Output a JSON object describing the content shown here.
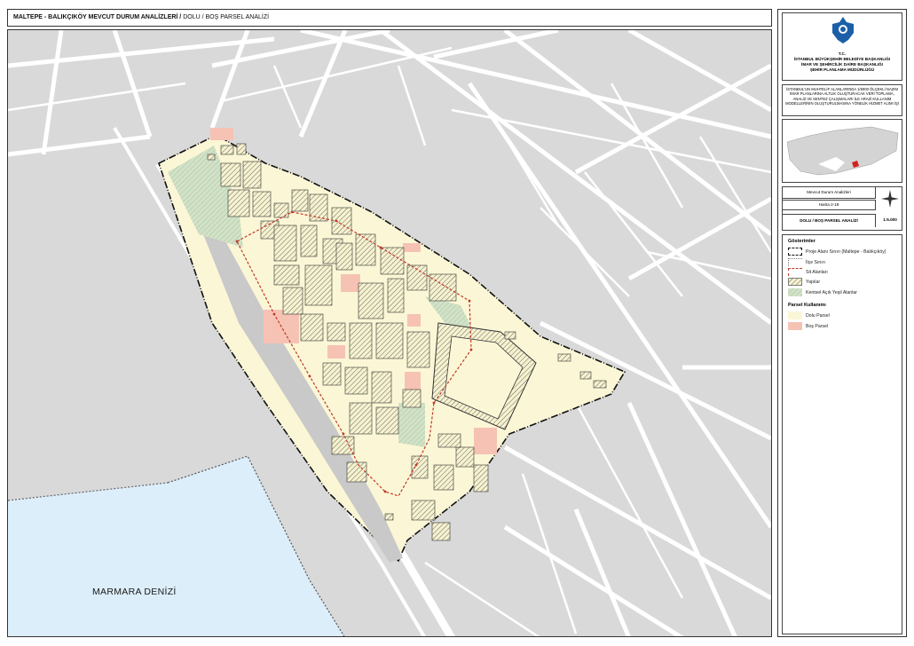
{
  "title": {
    "main": "MALTEPE - BALIKÇIKÖY MEVCUT DURUM ANALİZLERİ /",
    "sub": "DOLU / BOŞ PARSEL ANALİZİ"
  },
  "map": {
    "sea_label": "MARMARA DENİZİ"
  },
  "header": {
    "tc": "T.C.",
    "org1": "İSTANBUL BÜYÜKŞEHİR BELEDİYE BAŞKANLIĞI",
    "org2": "İMAR VE ŞEHİRCİLİK DAİRE BAŞKANLIĞI",
    "org3": "ŞEHİR PLANLAMA MÜDÜRLÜĞÜ"
  },
  "project_description": "İSTANBUL'UN MUHTELİF ALANLARINDA 1/5000 ÖLÇEKLİ NAZIM İMAR PLANLARINA ALTLIK OLUŞTURACAK VERİ TOPLAMA, ANALİZ VE SENTEZ ÇALIŞMALARI İLE ARAZİ KULLANIM MODELLERİNİN OLUŞTURULMASINA YÖNELİK HİZMET ALIMI İŞİ",
  "info": {
    "analysis_label": "Mevcut Durum Analizleri",
    "map_no": "Harita 2-18",
    "map_title": "DOLU / BOŞ PARSEL ANALİZİ",
    "scale": "1:5.000"
  },
  "legend": {
    "title": "Gösterimler",
    "items": [
      "Proje Alanı Sınırı (Maltepe - Balıkçıköy)",
      "İlçe Sınırı",
      "Sit Alanları",
      "Yapılar",
      "Kentsel Açık Yeşil Alanlar"
    ],
    "parcel_title": "Parsel Kullanımı",
    "parcel_items": [
      "Dolu Parsel",
      "Boş Parsel"
    ]
  },
  "colors": {
    "full_parcel": "#fbf7d6",
    "empty_parcel": "#f6c2b4",
    "sea": "#dceefa",
    "green": "#c9dcc0",
    "site": "#c0392b",
    "background": "#d9d9d9"
  }
}
